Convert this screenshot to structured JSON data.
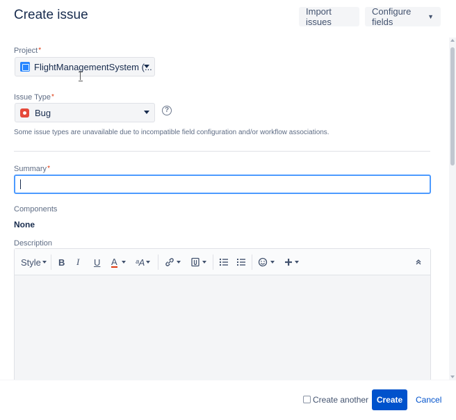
{
  "dialog": {
    "title": "Create issue",
    "import_label": "Import issues",
    "configure_label": "Configure fields"
  },
  "project": {
    "label": "Project",
    "required_mark": "*",
    "value": "FlightManagementSystem (...",
    "icon": "project-icon"
  },
  "issue_type": {
    "label": "Issue Type",
    "required_mark": "*",
    "value": "Bug",
    "icon": "bug-icon",
    "help_glyph": "?",
    "note": "Some issue types are unavailable due to incompatible field configuration and/or workflow associations."
  },
  "summary": {
    "label": "Summary",
    "required_mark": "*",
    "value": ""
  },
  "components": {
    "label": "Components",
    "value": "None"
  },
  "description": {
    "label": "Description",
    "toolbar": {
      "style": "Style",
      "bold": "B",
      "italic": "I",
      "underline": "U",
      "text_color": "A",
      "more_formatting": "ᵃA",
      "link_icon": "link-icon",
      "attachment_icon": "attachment-icon",
      "bullet_list_icon": "bullet-list-icon",
      "numbered_list_icon": "numbered-list-icon",
      "emoji_icon": "emoji-icon",
      "insert_icon": "plus-icon",
      "collapse_icon": "collapse-icon"
    }
  },
  "footer": {
    "create_another_label": "Create another",
    "create_another_checked": false,
    "create_label": "Create",
    "cancel_label": "Cancel"
  },
  "colors": {
    "primary": "#0052cc",
    "focus": "#4c9aff",
    "required": "#de350b",
    "text_color_underline": "#de350b"
  }
}
